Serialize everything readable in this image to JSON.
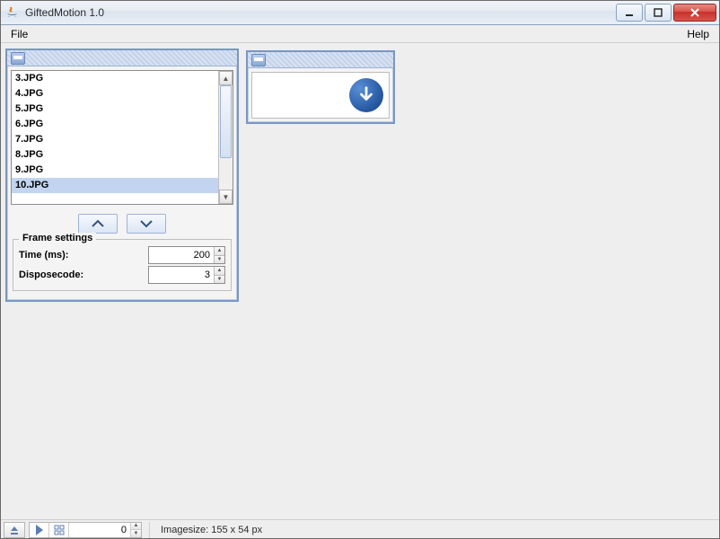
{
  "title": "GiftedMotion 1.0",
  "menu": {
    "file": "File",
    "help": "Help"
  },
  "frames_panel": {
    "files": [
      "3.JPG",
      "4.JPG",
      "5.JPG",
      "6.JPG",
      "7.JPG",
      "8.JPG",
      "9.JPG",
      "10.JPG"
    ],
    "selected_index": 7
  },
  "frame_settings": {
    "legend": "Frame settings",
    "time_label": "Time (ms):",
    "time_value": "200",
    "dispose_label": "Disposecode:",
    "dispose_value": "3"
  },
  "statusbar": {
    "frame_index": "0",
    "text": "Imagesize: 155 x 54 px"
  }
}
